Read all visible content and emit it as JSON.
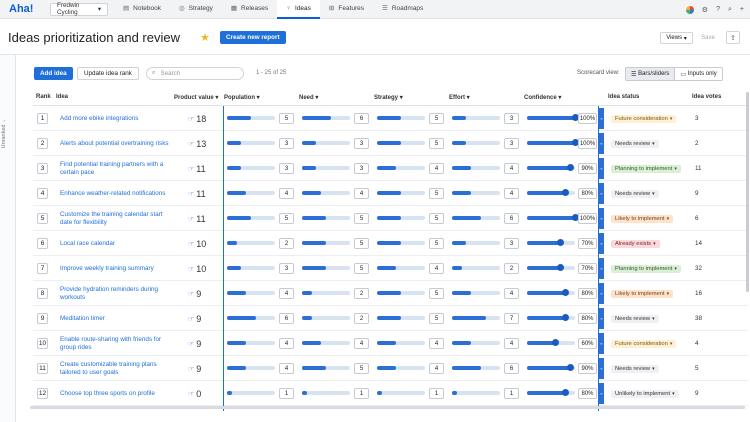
{
  "nav": {
    "logo": "Aha!",
    "workspace": "Fredwin Cycling",
    "tabs": [
      {
        "label": "Notebook",
        "icon": "notebook-icon",
        "glyph": "▤",
        "active": false
      },
      {
        "label": "Strategy",
        "icon": "strategy-icon",
        "glyph": "◎",
        "active": false
      },
      {
        "label": "Releases",
        "icon": "releases-icon",
        "glyph": "▦",
        "active": false
      },
      {
        "label": "Ideas",
        "icon": "lightbulb-icon",
        "glyph": "♀",
        "active": true
      },
      {
        "label": "Features",
        "icon": "features-icon",
        "glyph": "⊞",
        "active": false
      },
      {
        "label": "Roadmaps",
        "icon": "roadmaps-icon",
        "glyph": "☰",
        "active": false
      }
    ]
  },
  "header": {
    "title": "Ideas prioritization and review",
    "create_report": "Create new report",
    "views": "Views",
    "save": "Save"
  },
  "rail": {
    "label": "Unranked"
  },
  "toolbar": {
    "add_idea": "Add idea",
    "update_rank": "Update idea rank",
    "search_placeholder": "Search",
    "count": "1 - 25 of 25",
    "scorecard_label": "Scorecard view:",
    "bars_option": "Bars/sliders",
    "inputs_option": "Inputs only"
  },
  "columns": {
    "rank": "Rank",
    "idea": "Idea",
    "product_value": "Product value",
    "population": "Population",
    "need": "Need",
    "strategy": "Strategy",
    "effort": "Effort",
    "confidence": "Confidence",
    "status": "Idea status",
    "votes": "Idea votes"
  },
  "colors": {
    "accent": "#1f6fd9"
  },
  "rows": [
    {
      "rank": "1",
      "idea": "Add more ebike integrations",
      "pv": "18",
      "population": "5",
      "need": "6",
      "strategy": "5",
      "effort": "3",
      "confidence": "100%",
      "status": "Future consideration",
      "votes": "3"
    },
    {
      "rank": "2",
      "idea": "Alerts about potential overtraining risks",
      "pv": "13",
      "population": "3",
      "need": "3",
      "strategy": "5",
      "effort": "3",
      "confidence": "100%",
      "status": "Needs review",
      "votes": "2"
    },
    {
      "rank": "3",
      "idea": "Find potential training partners with a certain pace",
      "pv": "11",
      "population": "3",
      "need": "3",
      "strategy": "4",
      "effort": "4",
      "confidence": "90%",
      "status": "Planning to implement",
      "votes": "11"
    },
    {
      "rank": "4",
      "idea": "Enhance weather-related notifications",
      "pv": "11",
      "population": "4",
      "need": "4",
      "strategy": "5",
      "effort": "4",
      "confidence": "80%",
      "status": "Needs review",
      "votes": "9"
    },
    {
      "rank": "5",
      "idea": "Customize the training calendar start date for flexibility",
      "pv": "11",
      "population": "5",
      "need": "5",
      "strategy": "5",
      "effort": "6",
      "confidence": "100%",
      "status": "Likely to implement",
      "votes": "6"
    },
    {
      "rank": "6",
      "idea": "Local race calendar",
      "pv": "10",
      "population": "2",
      "need": "5",
      "strategy": "5",
      "effort": "3",
      "confidence": "70%",
      "status": "Already exists",
      "votes": "14"
    },
    {
      "rank": "7",
      "idea": "Improve weekly training summary",
      "pv": "10",
      "population": "3",
      "need": "5",
      "strategy": "4",
      "effort": "2",
      "confidence": "70%",
      "status": "Planning to implement",
      "votes": "32"
    },
    {
      "rank": "8",
      "idea": "Provide hydration reminders during workouts",
      "pv": "9",
      "population": "4",
      "need": "2",
      "strategy": "5",
      "effort": "4",
      "confidence": "80%",
      "status": "Likely to implement",
      "votes": "16"
    },
    {
      "rank": "9",
      "idea": "Meditation timer",
      "pv": "9",
      "population": "6",
      "need": "2",
      "strategy": "5",
      "effort": "7",
      "confidence": "80%",
      "status": "Needs review",
      "votes": "38"
    },
    {
      "rank": "10",
      "idea": "Enable route-sharing with friends for group rides",
      "pv": "9",
      "population": "4",
      "need": "4",
      "strategy": "4",
      "effort": "4",
      "confidence": "60%",
      "status": "Future consideration",
      "votes": "4"
    },
    {
      "rank": "11",
      "idea": "Create customizable training plans tailored to user goals",
      "pv": "9",
      "population": "4",
      "need": "5",
      "strategy": "4",
      "effort": "6",
      "confidence": "90%",
      "status": "Needs review",
      "votes": "5"
    },
    {
      "rank": "12",
      "idea": "Choose top three sports on profile",
      "pv": "0",
      "population": "1",
      "need": "1",
      "strategy": "1",
      "effort": "1",
      "confidence": "80%",
      "status": "Unlikely to implement",
      "votes": "9"
    }
  ],
  "status_colors": {
    "Future consideration": {
      "bg": "#fdf0d5",
      "fg": "#7a5a10"
    },
    "Needs review": {
      "bg": "#eef0f3",
      "fg": "#333333"
    },
    "Planning to implement": {
      "bg": "#dcefd6",
      "fg": "#2f5d22"
    },
    "Likely to implement": {
      "bg": "#fde3cc",
      "fg": "#7a4012"
    },
    "Already exists": {
      "bg": "#f9d9dc",
      "fg": "#7a1f2a"
    },
    "Unlikely to implement": {
      "bg": "#eef0f3",
      "fg": "#333333"
    }
  }
}
